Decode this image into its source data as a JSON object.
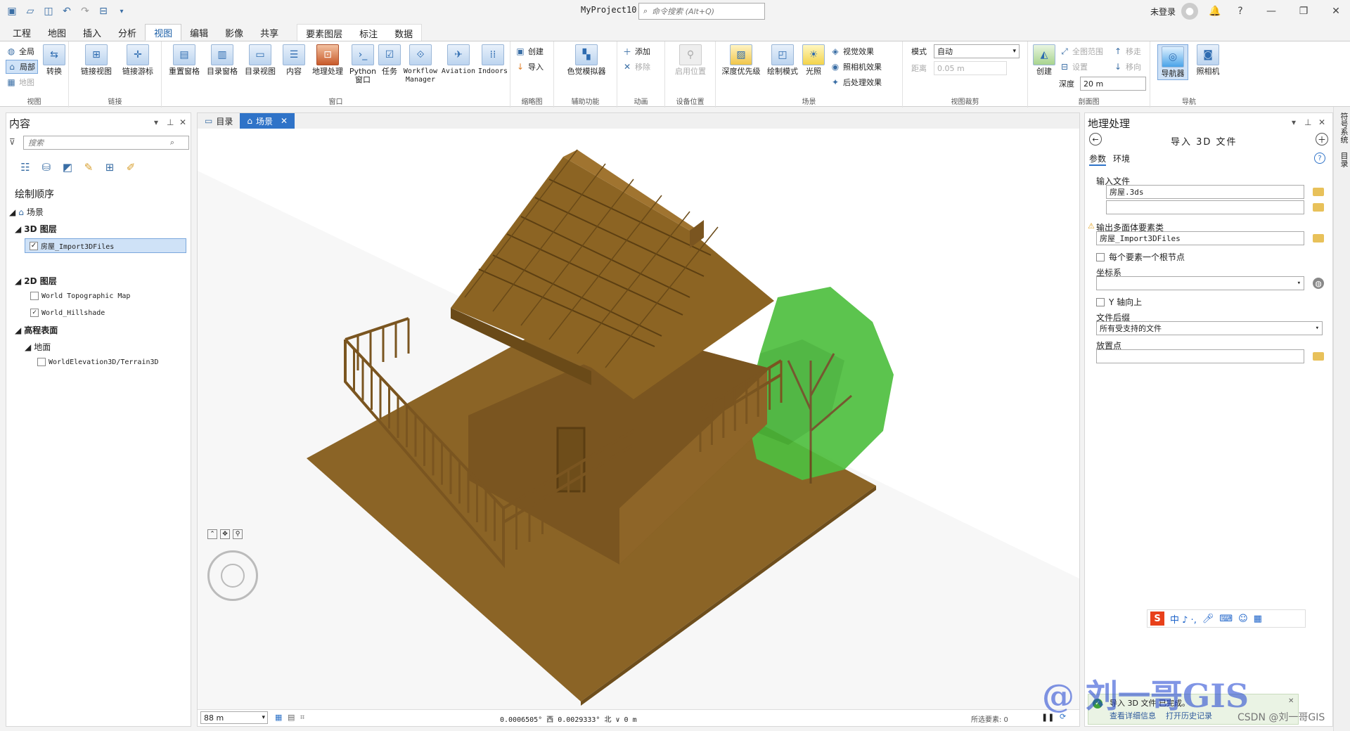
{
  "window": {
    "title": "MyProject10",
    "search_placeholder": "命令搜索 (Alt+Q)",
    "user": "未登录"
  },
  "ribbon_tabs": [
    "工程",
    "地图",
    "插入",
    "分析",
    "视图",
    "编辑",
    "影像",
    "共享",
    "要素图层",
    "标注",
    "数据"
  ],
  "active_tab": "视图",
  "ribbon": {
    "view_group": {
      "label": "视图",
      "global": "全局",
      "local": "局部",
      "map": "地图",
      "convert": "转换"
    },
    "link_group": {
      "label": "链接",
      "link_views": "链接视图",
      "link_cursors": "链接游标"
    },
    "window_group": {
      "label": "窗口",
      "reset_panes": "重置窗格",
      "catalog_pane": "目录窗格",
      "catalog_view": "目录视图",
      "contents": "内容",
      "geoprocessing": "地理处理",
      "python": "Python\n窗口",
      "tasks": "任务",
      "workflow": "Workflow\nManager",
      "aviation": "Aviation",
      "indoors": "Indoors"
    },
    "thumb_group": {
      "label": "缩略图",
      "create": "创建",
      "import": "导入"
    },
    "access_group": {
      "label": "辅助功能",
      "color_sim": "色觉模拟器"
    },
    "anim_group": {
      "label": "动画",
      "add": "添加",
      "remove": "移除"
    },
    "device_group": {
      "label": "设备位置",
      "enable": "启用位置"
    },
    "scene_group": {
      "label": "场景",
      "depth": "深度优先级",
      "draw_mode": "绘制模式",
      "lighting": "光照",
      "visual": "视觉效果",
      "camera": "照相机效果",
      "post": "后处理效果"
    },
    "clip_group": {
      "label": "视图裁剪",
      "mode_label": "模式",
      "mode_value": "自动",
      "distance_label": "距离",
      "distance_value": "0.05  m"
    },
    "section_group": {
      "label": "剖面图",
      "create": "创建",
      "full_extent": "全图范围",
      "settings": "设置",
      "move_in": "移走",
      "move_out": "移向",
      "depth_label": "深度",
      "depth_value": "20 m"
    },
    "nav_group": {
      "label": "导航",
      "navigator": "导航器",
      "camera": "照相机"
    }
  },
  "contents_pane": {
    "title": "内容",
    "search_placeholder": "搜索",
    "drawing_order": "绘制顺序",
    "scene": "场景",
    "layers_3d": "3D 图层",
    "layer_house": "房屋_Import3DFiles",
    "layers_2d": "2D 图层",
    "topo": "World Topographic Map",
    "hillshade": "World_Hillshade",
    "elevation": "高程表面",
    "ground": "地面",
    "terrain": "WorldElevation3D/Terrain3D"
  },
  "scene_tabs": [
    {
      "label": "目录"
    },
    {
      "label": "场景"
    }
  ],
  "scene_status": {
    "scale": "88 m",
    "coords": "0.0006505° 西 0.0029333° 北  ∨  0 m",
    "selected": "所选要素: 0"
  },
  "gp_pane": {
    "title": "地理处理",
    "tool": "导入 3D 文件",
    "tab_params": "参数",
    "tab_env": "环境",
    "input_label": "输入文件",
    "input_value": "房屋.3ds",
    "output_label": "输出多面体要素类",
    "output_value": "房屋_Import3DFiles",
    "root_label": "每个要素一个根节点",
    "cs_label": "坐标系",
    "yup_label": "Y 轴向上",
    "suffix_label": "文件后缀",
    "suffix_value": "所有受支持的文件",
    "placement_label": "放置点",
    "done_msg": "导入 3D 文件 已完成。",
    "view_details": "查看详细信息",
    "open_history": "打开历史记录"
  },
  "sidebar": {
    "symbology": "符号系统",
    "catalog": "目录"
  },
  "watermark": {
    "text": "@ 刘一哥GIS",
    "csdn": "CSDN @刘一哥GIS"
  },
  "ime": {
    "chars": "中 ♪ ·,"
  },
  "colors": {
    "accent": "#2f73c8",
    "house": "#8b6426",
    "tree": "#4fbf3f"
  }
}
